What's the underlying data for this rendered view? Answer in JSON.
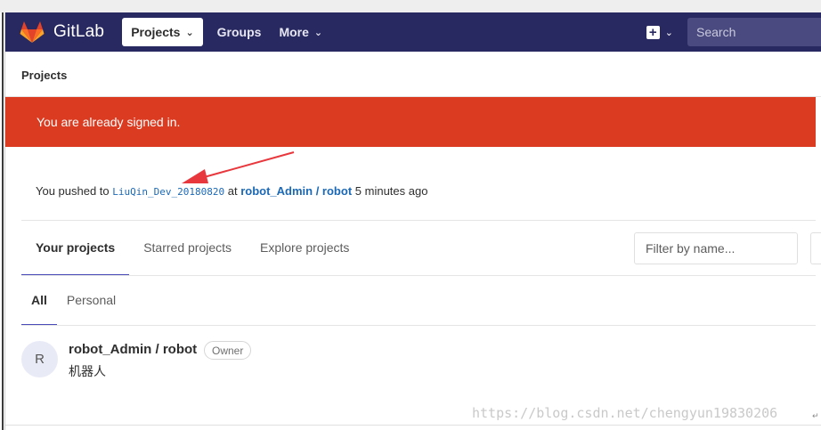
{
  "navbar": {
    "brand": "GitLab",
    "projects_label": "Projects",
    "groups_label": "Groups",
    "more_label": "More",
    "search_placeholder": "Search"
  },
  "breadcrumb": {
    "label": "Projects"
  },
  "alert": {
    "message": "You are already signed in."
  },
  "push_event": {
    "prefix": "You pushed to",
    "branch": "LiuQin_Dev_20180820",
    "at": "at",
    "project": "robot_Admin / robot",
    "time": "5 minutes ago"
  },
  "tabs": [
    {
      "label": "Your projects",
      "active": true
    },
    {
      "label": "Starred projects",
      "active": false
    },
    {
      "label": "Explore projects",
      "active": false
    }
  ],
  "filter": {
    "placeholder": "Filter by name..."
  },
  "subtabs": [
    {
      "label": "All",
      "active": true
    },
    {
      "label": "Personal",
      "active": false
    }
  ],
  "projects": [
    {
      "avatar_letter": "R",
      "name": "robot_Admin / robot",
      "role": "Owner",
      "description": "机器人"
    }
  ],
  "watermark": "https://blog.csdn.net/chengyun19830206",
  "colors": {
    "navbar": "#292961",
    "alert": "#db3b21",
    "link": "#1b69b6",
    "annotation_arrow": "#e8383d"
  }
}
